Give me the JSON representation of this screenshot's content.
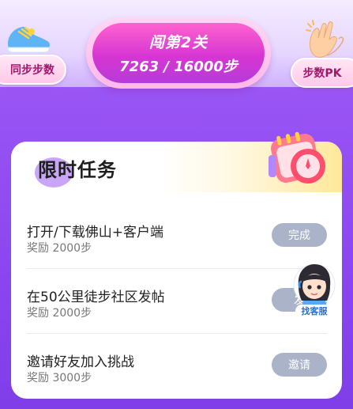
{
  "level": {
    "title": "闯第2关",
    "steps": "7263 / 16000步",
    "progress": 0.454
  },
  "side_buttons": {
    "sync_label": "同步步数",
    "pk_label": "步数PK"
  },
  "tasks_card": {
    "title": "限时任务",
    "tasks": [
      {
        "name": "打开/下载佛山+客户端",
        "reward": "奖励 2000步",
        "button": "完成"
      },
      {
        "name": "在50公里徒步社区发帖",
        "reward": "奖励 2000步",
        "button": "发"
      },
      {
        "name": "邀请好友加入挑战",
        "reward": "奖励 3000步",
        "button": "邀请"
      }
    ]
  },
  "customer_service": {
    "label": "找客服"
  },
  "colors": {
    "background": "#8b46f0",
    "level_pill": "#d736d2",
    "task_button": "#aab3c7",
    "pill_text": "#a0186a"
  }
}
